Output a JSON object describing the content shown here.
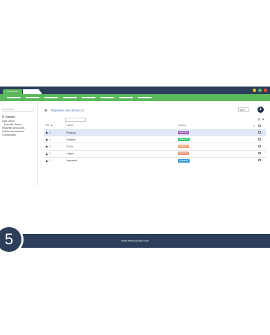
{
  "titlebar": {
    "brand_tab": "NextSolution",
    "window_dots": [
      "#f0c30f",
      "#5cb85c",
      "#e74c3c"
    ]
  },
  "sidebar": {
    "search_placeholder": "Rechercher",
    "caret": "▾",
    "title": "IT Checkt",
    "links": [
      "Liste checkt",
      "Nouvelle checkt",
      "Étiquettes des tâches",
      "Gestion des dossiers",
      "Configuration"
    ]
  },
  "main": {
    "heading": "Étiquettes des tâches",
    "heading_count": "(5)",
    "per_page": "25 ▾",
    "add_icon": "plus-icon",
    "columns": {
      "ref": "Réf. ▲",
      "label": "Libellé",
      "color": "Couleur"
    },
    "rows": [
      {
        "ref": "5",
        "label": "Pending",
        "color_text": "#9B59B6",
        "color": "#9b59b6",
        "selected": true
      },
      {
        "ref": "4",
        "label": "Finished",
        "color_text": "#2ECC71",
        "color": "#2ecc71",
        "selected": false
      },
      {
        "ref": "3",
        "label": "To Do",
        "color_text": "#F0A271",
        "color": "#f0a271",
        "selected": false
      },
      {
        "ref": "2",
        "label": "Urgent",
        "color_text": "#E7937A",
        "color": "#e7937a",
        "selected": false
      },
      {
        "ref": "1",
        "label": "Important",
        "color_text": "#3498DB",
        "color": "#3498db",
        "selected": false
      }
    ]
  },
  "footer": {
    "url": "www.nextsolution.com"
  },
  "step": {
    "number": "5"
  }
}
